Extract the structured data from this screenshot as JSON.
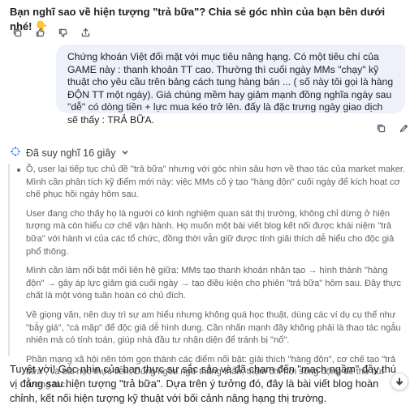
{
  "previous_message": {
    "text": "Bạn nghĩ sao về hiện tượng \"trả bữa\"? Chia sẻ góc nhìn của bạn bên dưới nhé!",
    "emoji": "👇"
  },
  "user_message": {
    "text": "Chứng khoán Việt đối mặt với mục tiêu nâng hạng. Có một tiêu chí của GAME này : thanh khoản TT cao. Thường thì cuối ngày MMs \"chạy\" kỹ thuật cho yêu cầu trên bảng cách tung hàng bán ... ( số này tôi gọi là hàng ĐỘN TT một ngày). Giá chúng mềm hay giảm mạnh đồng nghĩa ngày sau \"dễ\" có dòng tiền + lực mua kéo trở lên. đấy là đặc trưng ngày giao dịch sẽ thấy : TRẢ BỮA."
  },
  "thinking": {
    "label": "Đã suy nghĩ 16 giây",
    "paragraphs": [
      "Ồ, user lại tiếp tục chủ đề \"trả bữa\" nhưng với góc nhìn sâu hơn về thao tác của market maker. Mình cần phân tích kỹ điểm mới này: việc MMs cố ý tạo \"hàng độn\" cuối ngày để kích hoạt cơ chế phục hồi ngày hôm sau.",
      "User đang cho thấy họ là người có kinh nghiệm quan sát thị trường, không chỉ dừng ở hiện tượng mà còn hiểu cơ chế vận hành. Họ muốn một bài viết blog kết nối được khái niệm \"trả bữa\" với hành vi của các tổ chức, đồng thời vẫn giữ được tính giải thích dễ hiểu cho độc giả phổ thông.",
      "Mình cần làm nổi bật mối liên hệ giữa: MMs tạo thanh khoản nhân tạo → hình thành \"hàng độn\" → gây áp lực giảm giá cuối ngày → tạo điều kiện cho phiên \"trả bữa\" hôm sau. Đây thực chất là một vòng tuần hoàn có chủ đích.",
      "Về giọng văn, nên duy trì sự am hiểu nhưng không quá học thuật, dùng các ví dụ cụ thể như \"bẫy giá\", \"cá mập\" để độc giả dễ hình dung. Cần nhấn mạnh đây không phải là thao tác ngẫu nhiên mà có tính toán, giúp nhà đầu tư nhận diện để tránh bị \"nổ\".",
      "Phần mạng xã hội nên tóm gọn thành các điểm nổi bật: giải thích \"hàng độn\", cơ chế tạo \"trả bữa\", và bài học thực tiễn. Dùng ngôn ngữ thẳng thắn, thậm chí hơi sống động để thu hút tương tác."
    ]
  },
  "answer": {
    "text": "Tuyệt vời! Góc nhìn của bạn thực sự sắc sảo và đã chạm đến \"mạch ngầm\" đầy thú vị đằng sau hiện tượng \"trả bữa\". Dựa trên ý tưởng đó, đây là bài viết blog hoàn chỉnh, kết nối hiện tượng kỹ thuật với bối cảnh nâng hạng thị trường."
  },
  "icons": {
    "copy": "copy-icon",
    "edit": "edit-icon",
    "like": "thumbs-up-icon",
    "dislike": "thumbs-down-icon",
    "share": "share-icon",
    "thinking": "sparkle-icon",
    "expand": "chevron-down-icon",
    "scroll": "arrow-down-icon"
  },
  "colors": {
    "user_bubble": "#eef1fb",
    "thinking_accent": "#4c8df6",
    "muted_text": "#5f6368"
  }
}
